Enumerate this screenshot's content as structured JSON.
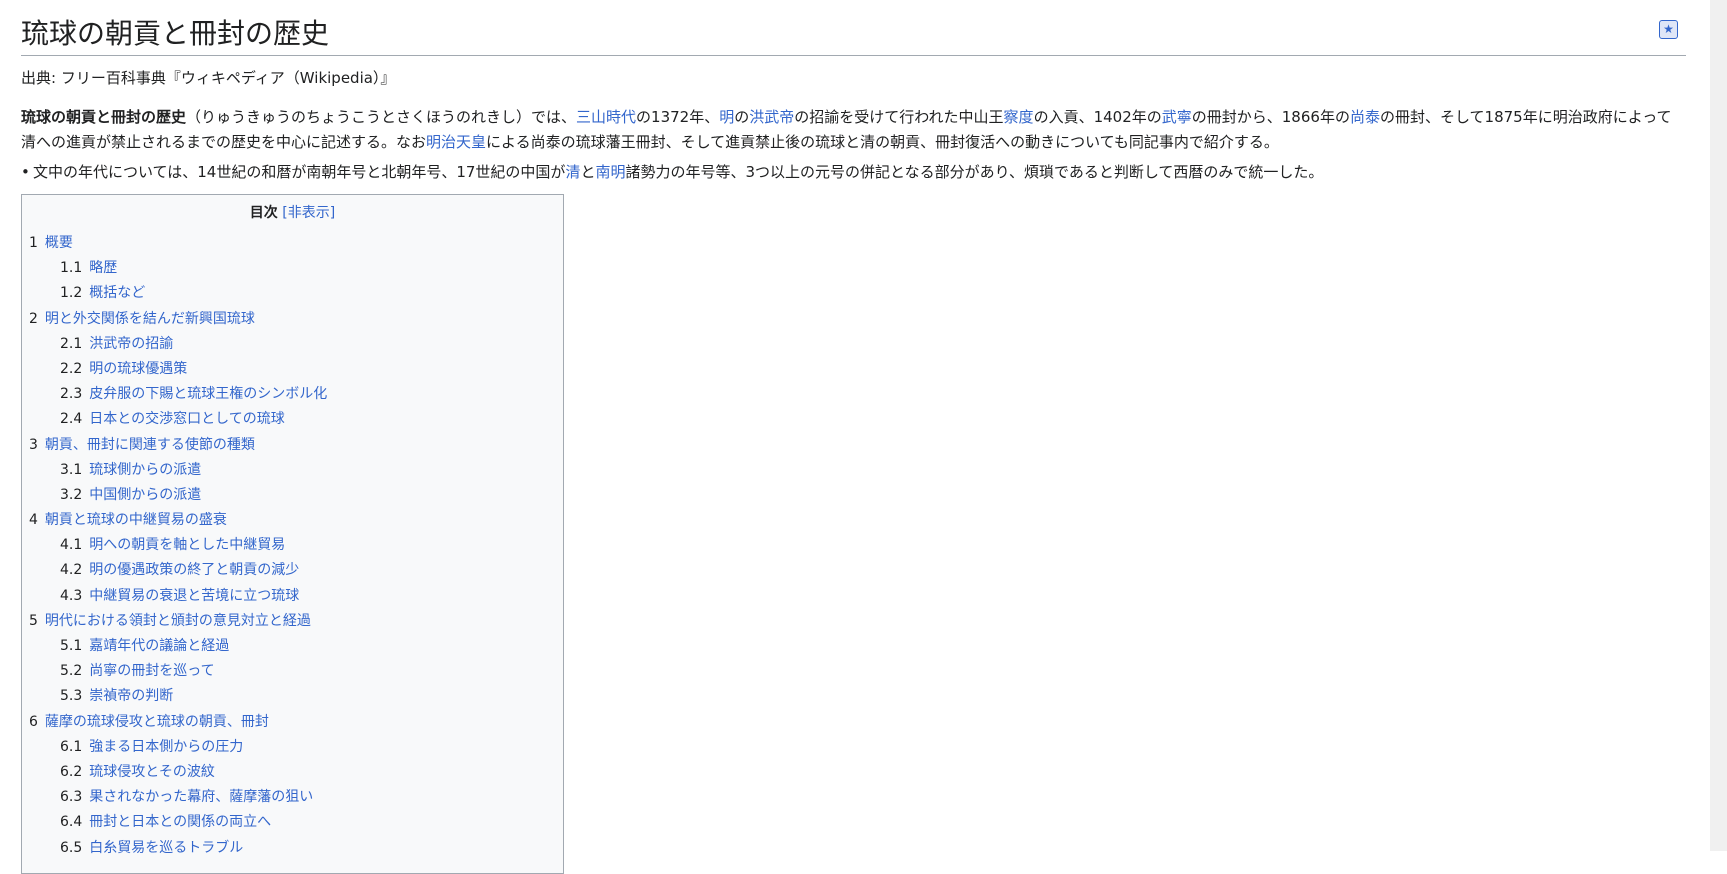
{
  "article": {
    "title": "琉球の朝貢と冊封の歴史",
    "sitesub": "出典: フリー百科事典『ウィキペディア（Wikipedia）』",
    "lead": {
      "bold": "琉球の朝貢と冊封の歴史",
      "t1": "（りゅうきゅうのちょうこうとさくほうのれきし）では、",
      "l1": "三山時代",
      "t2": "の1372年、",
      "l2": "明",
      "t3": "の",
      "l3": "洪武帝",
      "t4": "の招諭を受けて行われた中山王",
      "l4": "察度",
      "t5": "の入貢、1402年の",
      "l5": "武寧",
      "t6": "の冊封から、1866年の",
      "l6": "尚泰",
      "t7": "の冊封、そして1875年に明治政府によって清への進貢が禁止されるまでの歴史を中心に記述する。なお",
      "l7": "明治天皇",
      "t8": "による尚泰の琉球藩王冊封、そして進貢禁止後の琉球と清の朝貢、冊封復活への動きについても同記事内で紹介する。"
    },
    "note": {
      "t1": "文中の年代については、14世紀の和暦が南朝年号と北朝年号、17世紀の中国が",
      "l1": "清",
      "t2": "と",
      "l2": "南明",
      "t3": "諸勢力の年号等、3つ以上の元号の併記となる部分があり、煩瑣であると判断して西暦のみで統一した。"
    }
  },
  "toc": {
    "title": "目次",
    "toggle": "[非表示]",
    "items": [
      {
        "num": "1",
        "text": "概要"
      },
      {
        "num": "1.1",
        "text": "略歴"
      },
      {
        "num": "1.2",
        "text": "概括など"
      },
      {
        "num": "2",
        "text": "明と外交関係を結んだ新興国琉球"
      },
      {
        "num": "2.1",
        "text": "洪武帝の招諭"
      },
      {
        "num": "2.2",
        "text": "明の琉球優遇策"
      },
      {
        "num": "2.3",
        "text": "皮弁服の下賜と琉球王権のシンボル化"
      },
      {
        "num": "2.4",
        "text": "日本との交渉窓口としての琉球"
      },
      {
        "num": "3",
        "text": "朝貢、冊封に関連する使節の種類"
      },
      {
        "num": "3.1",
        "text": "琉球側からの派遣"
      },
      {
        "num": "3.2",
        "text": "中国側からの派遣"
      },
      {
        "num": "4",
        "text": "朝貢と琉球の中継貿易の盛衰"
      },
      {
        "num": "4.1",
        "text": "明への朝貢を軸とした中継貿易"
      },
      {
        "num": "4.2",
        "text": "明の優遇政策の終了と朝貢の減少"
      },
      {
        "num": "4.3",
        "text": "中継貿易の衰退と苦境に立つ琉球"
      },
      {
        "num": "5",
        "text": "明代における領封と頒封の意見対立と経過"
      },
      {
        "num": "5.1",
        "text": "嘉靖年代の議論と経過"
      },
      {
        "num": "5.2",
        "text": "尚寧の冊封を巡って"
      },
      {
        "num": "5.3",
        "text": "崇禎帝の判断"
      },
      {
        "num": "6",
        "text": "薩摩の琉球侵攻と琉球の朝貢、冊封"
      },
      {
        "num": "6.1",
        "text": "強まる日本側からの圧力"
      },
      {
        "num": "6.2",
        "text": "琉球侵攻とその波紋"
      },
      {
        "num": "6.3",
        "text": "果されなかった幕府、薩摩藩の狙い"
      },
      {
        "num": "6.4",
        "text": "冊封と日本との関係の両立へ"
      },
      {
        "num": "6.5",
        "text": "白糸貿易を巡るトラブル"
      }
    ]
  }
}
